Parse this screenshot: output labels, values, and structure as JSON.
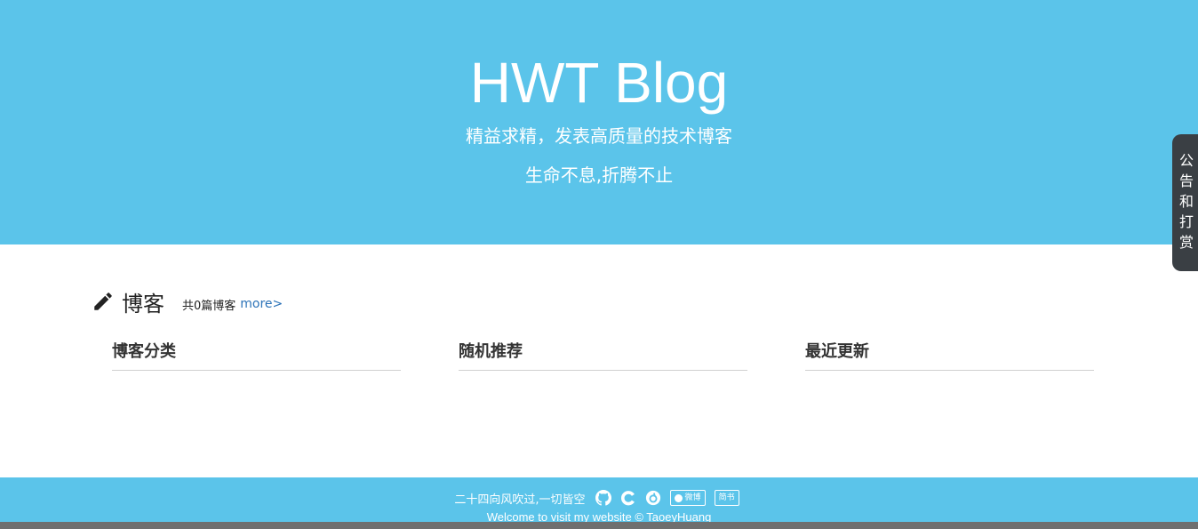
{
  "hero": {
    "title": "HWT Blog",
    "subtitle": "精益求精，发表高质量的技术博客",
    "motto": "生命不息,折腾不止"
  },
  "side_tab": {
    "chars": [
      "公",
      "告",
      "和",
      "打",
      "赏"
    ]
  },
  "blog": {
    "icon": "pencil-icon",
    "title": "博客",
    "count": "共0篇博客",
    "more": "more>"
  },
  "columns": {
    "categories": "博客分类",
    "random": "随机推荐",
    "recent": "最近更新"
  },
  "footer": {
    "motto": "二十四向风吹过,一切皆空",
    "icons": [
      "github-icon",
      "csdn-icon",
      "netease-music-icon"
    ],
    "badge1": "微博",
    "badge2": "简书",
    "copyright": "Welcome to visit my website © TaoeyHuang"
  },
  "colors": {
    "hero_bg": "#5bc4ea",
    "side_tab_bg": "#3a3f44",
    "link": "#2c73b8"
  }
}
